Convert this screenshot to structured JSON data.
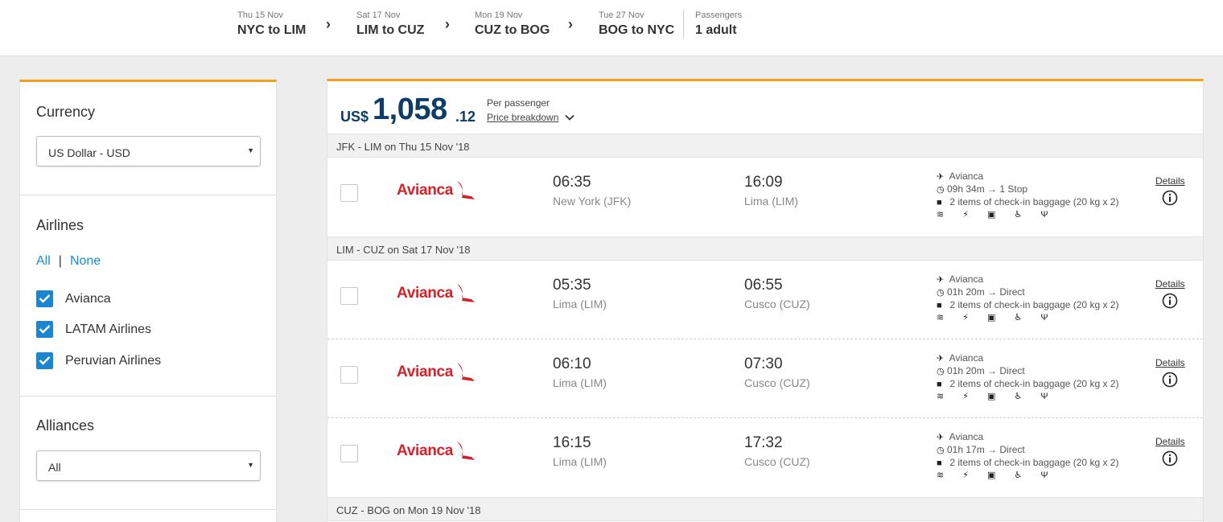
{
  "trip_bar": {
    "legs": [
      {
        "date": "Thu 15 Nov",
        "route": "NYC to LIM"
      },
      {
        "date": "Sat 17 Nov",
        "route": "LIM to CUZ"
      },
      {
        "date": "Mon 19 Nov",
        "route": "CUZ to BOG"
      },
      {
        "date": "Tue 27 Nov",
        "route": "BOG to NYC"
      }
    ],
    "passengers_label": "Passengers",
    "passengers_value": "1 adult",
    "chevron": "›"
  },
  "sidebar": {
    "currency": {
      "title": "Currency",
      "selected": "US Dollar - USD"
    },
    "airlines": {
      "title": "Airlines",
      "all_label": "All",
      "separator": "|",
      "none_label": "None",
      "items": [
        {
          "label": "Avianca",
          "checked": true
        },
        {
          "label": "LATAM Airlines",
          "checked": true
        },
        {
          "label": "Peruvian Airlines",
          "checked": true
        }
      ]
    },
    "alliances": {
      "title": "Alliances",
      "selected": "All"
    },
    "select_caret": "▼"
  },
  "price": {
    "currency": "US$",
    "amount": "1,058",
    "cents": ".12",
    "per_passenger": "Per passenger",
    "breakdown_label": "Price breakdown"
  },
  "segments": [
    {
      "header": "JFK - LIM on Thu 15 Nov '18",
      "flights": [
        {
          "airline": "Avianca",
          "dep_time": "06:35",
          "dep_place": "New York (JFK)",
          "arr_time": "16:09",
          "arr_place": "Lima (LIM)",
          "operator": "Avianca",
          "duration": "09h 34m → 1 Stop",
          "baggage": "2 items of check-in baggage (20 kg x 2)",
          "details": "Details"
        }
      ]
    },
    {
      "header": "LIM - CUZ on Sat 17 Nov '18",
      "flights": [
        {
          "airline": "Avianca",
          "dep_time": "05:35",
          "dep_place": "Lima (LIM)",
          "arr_time": "06:55",
          "arr_place": "Cusco (CUZ)",
          "operator": "Avianca",
          "duration": "01h 20m → Direct",
          "baggage": "2 items of check-in baggage (20 kg x 2)",
          "details": "Details"
        },
        {
          "airline": "Avianca",
          "dep_time": "06:10",
          "dep_place": "Lima (LIM)",
          "arr_time": "07:30",
          "arr_place": "Cusco (CUZ)",
          "operator": "Avianca",
          "duration": "01h 20m → Direct",
          "baggage": "2 items of check-in baggage (20 kg x 2)",
          "details": "Details"
        },
        {
          "airline": "Avianca",
          "dep_time": "16:15",
          "dep_place": "Lima (LIM)",
          "arr_time": "17:32",
          "arr_place": "Cusco (CUZ)",
          "operator": "Avianca",
          "duration": "01h 17m → Direct",
          "baggage": "2 items of check-in baggage (20 kg x 2)",
          "details": "Details"
        }
      ]
    },
    {
      "header": "CUZ - BOG on Mon 19 Nov '18",
      "flights": []
    }
  ],
  "icons": {
    "plane": "✈",
    "clock": "◷",
    "bag": "■",
    "amenities": "≋ ⚡ ▣ ♿ Ψ"
  },
  "colors": {
    "accent_orange": "#f5a01c",
    "price_navy": "#0e3c68",
    "link_blue": "#1a8bd8",
    "checkbox_blue": "#1b86cf",
    "avianca_red": "#d2232a"
  }
}
